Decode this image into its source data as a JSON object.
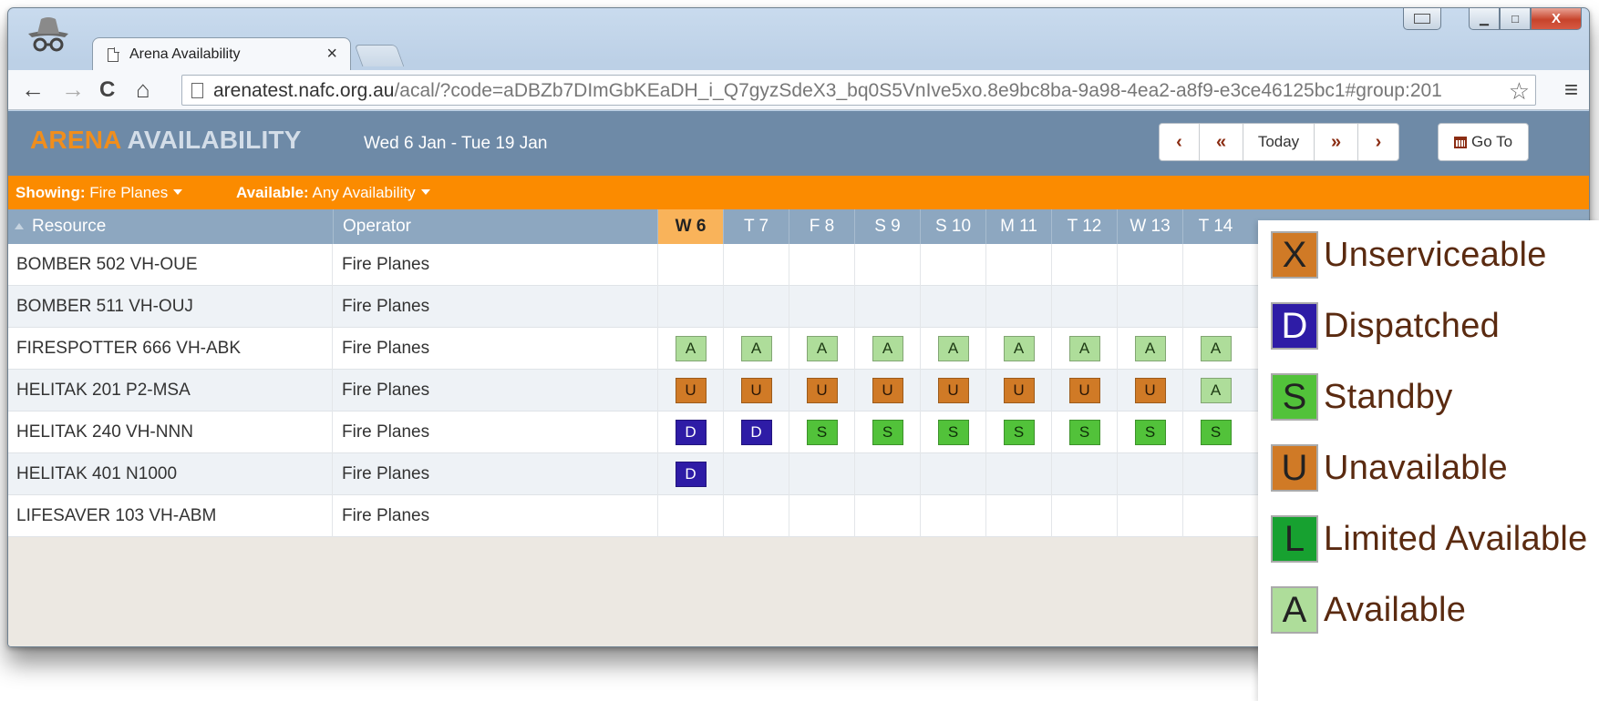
{
  "browser": {
    "tab_title": "Arena Availability",
    "tab_close": "×",
    "url_host": "arenatest.nafc.org.au",
    "url_rest": "/acal/?code=aDBZb7DImGbKEaDH_i_Q7gyzSdeX3_bq0S5VnIve5xo.8e9bc8ba-9a98-4ea2-a8f9-e3ce46125bc1#group:201",
    "back_icon": "←",
    "forward_icon": "→",
    "reload_icon": "C",
    "home_icon": "⌂",
    "star_icon": "☆",
    "menu_icon": "≡",
    "min_label": "▁",
    "max_label": "□",
    "close_label": "X"
  },
  "app": {
    "brand_part1": "ARENA",
    "brand_part2": "AVAILABILITY",
    "date_range": "Wed 6 Jan - Tue 19 Jan",
    "nav": {
      "prev_label": "‹",
      "prev_fast_label": "«",
      "today_label": "Today",
      "next_fast_label": "»",
      "next_label": "›"
    },
    "goto_label": "Go To"
  },
  "filters": {
    "showing_label": "Showing:",
    "showing_value": "Fire Planes",
    "available_label": "Available:",
    "available_value": "Any Availability"
  },
  "table": {
    "col_resource": "Resource",
    "col_operator": "Operator",
    "days": [
      "W 6",
      "T 7",
      "F 8",
      "S 9",
      "S 10",
      "M 11",
      "T 12",
      "W 13",
      "T 14"
    ],
    "rows": [
      {
        "resource": "BOMBER 502 VH-OUE",
        "operator": "Fire Planes",
        "status": [
          "",
          "",
          "",
          "",
          "",
          "",
          "",
          "",
          ""
        ]
      },
      {
        "resource": "BOMBER 511 VH-OUJ",
        "operator": "Fire Planes",
        "status": [
          "",
          "",
          "",
          "",
          "",
          "",
          "",
          "",
          ""
        ]
      },
      {
        "resource": "FIRESPOTTER 666 VH-ABK",
        "operator": "Fire Planes",
        "status": [
          "A",
          "A",
          "A",
          "A",
          "A",
          "A",
          "A",
          "A",
          "A"
        ]
      },
      {
        "resource": "HELITAK 201 P2-MSA",
        "operator": "Fire Planes",
        "status": [
          "U",
          "U",
          "U",
          "U",
          "U",
          "U",
          "U",
          "U",
          "A"
        ]
      },
      {
        "resource": "HELITAK 240 VH-NNN",
        "operator": "Fire Planes",
        "status": [
          "D",
          "D",
          "S",
          "S",
          "S",
          "S",
          "S",
          "S",
          "S"
        ]
      },
      {
        "resource": "HELITAK 401 N1000",
        "operator": "Fire Planes",
        "status": [
          "D",
          "",
          "",
          "",
          "",
          "",
          "",
          "",
          ""
        ]
      },
      {
        "resource": "LIFESAVER 103 VH-ABM",
        "operator": "Fire Planes",
        "status": [
          "",
          "",
          "",
          "",
          "",
          "",
          "",
          "",
          ""
        ]
      }
    ]
  },
  "legend": [
    {
      "code": "X",
      "label": "Unserviceable",
      "color": "#d07a26",
      "text_color": "#222222"
    },
    {
      "code": "D",
      "label": "Dispatched",
      "color": "#2e1ca6",
      "text_color": "#ffffff"
    },
    {
      "code": "S",
      "label": "Standby",
      "color": "#52c23a",
      "text_color": "#222222"
    },
    {
      "code": "U",
      "label": "Unavailable",
      "color": "#d07a26",
      "text_color": "#222222"
    },
    {
      "code": "L",
      "label": "Limited Available",
      "color": "#17a130",
      "text_color": "#222222"
    },
    {
      "code": "A",
      "label": "Available",
      "color": "#aedd9a",
      "text_color": "#222222"
    }
  ],
  "colors": {
    "header_bg": "#6e8aa7",
    "filter_bar": "#fb8b00",
    "brand_accent": "#f08e1d",
    "today_column": "#f9b35a"
  }
}
